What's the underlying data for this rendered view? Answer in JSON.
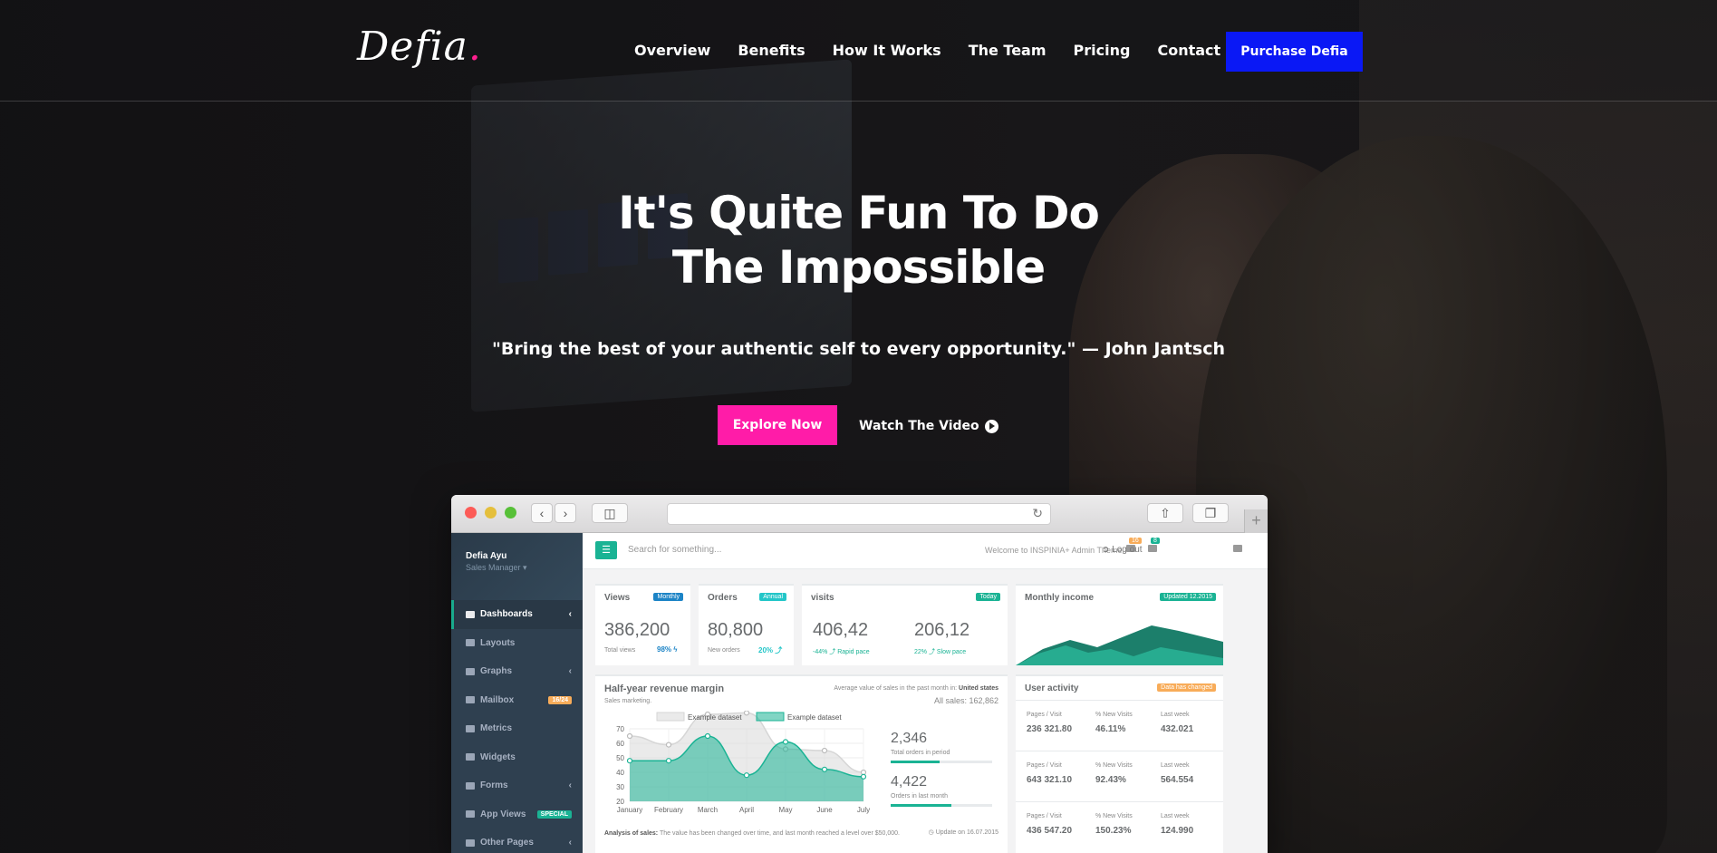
{
  "brand": {
    "logo": "Defia",
    "logo_dot": "."
  },
  "nav": {
    "items": [
      "Overview",
      "Benefits",
      "How It Works",
      "The Team",
      "Pricing",
      "Contact Us"
    ]
  },
  "header_cta": "Purchase Defia",
  "hero": {
    "title_line1": "It's Quite Fun To Do",
    "title_line2": "The Impossible",
    "quote": "\"Bring the best of your authentic self to every opportunity.\" — John Jantsch",
    "primary_button": "Explore Now",
    "secondary_button": "Watch The Video"
  },
  "colors": {
    "accent_pink": "#ff1ca8",
    "accent_blue": "#0a18f5",
    "teal": "#1ab394",
    "sidebar": "#2f4050"
  },
  "dashboard": {
    "profile": {
      "name": "Defia Ayu",
      "role": "Sales Manager ▾"
    },
    "sidebar": [
      {
        "label": "Dashboards",
        "arrow": "‹",
        "active": true
      },
      {
        "label": "Layouts"
      },
      {
        "label": "Graphs",
        "arrow": "‹"
      },
      {
        "label": "Mailbox",
        "badge": "16/24"
      },
      {
        "label": "Metrics"
      },
      {
        "label": "Widgets"
      },
      {
        "label": "Forms",
        "arrow": "‹"
      },
      {
        "label": "App Views",
        "badge": "SPECIAL"
      },
      {
        "label": "Other Pages",
        "arrow": "‹"
      }
    ],
    "topbar": {
      "search_placeholder": "Search for something...",
      "welcome": "Welcome to INSPINIA+ Admin Theme.",
      "mail_badge": "16",
      "bell_badge": "8",
      "logout": "Log out"
    },
    "stats": {
      "views": {
        "title": "Views",
        "label": "Monthly",
        "value": "386,200",
        "sub": "Total views",
        "pct": "98% ϟ"
      },
      "orders": {
        "title": "Orders",
        "label": "Annual",
        "value": "80,800",
        "sub": "New orders",
        "pct": "20% ⤴"
      },
      "visits": {
        "title": "visits",
        "label": "Today",
        "value1": "406,42",
        "sub1": "-44% ⤴ Rapid pace",
        "value2": "206,12",
        "sub2": "22% ⤴ Slow pace"
      },
      "income": {
        "title": "Monthly income",
        "label": "Updated 12.2015"
      }
    },
    "revenue": {
      "title": "Half-year revenue margin",
      "subtitle": "Sales marketing.",
      "avg_text": "Average value of sales in the past month in:",
      "avg_place": "United states",
      "all_sales": "All sales: 162,862",
      "stat1_value": "2,346",
      "stat1_label": "Total orders in period",
      "stat1_progress": 0.48,
      "stat2_value": "4,422",
      "stat2_label": "Orders in last month",
      "stat2_progress": 0.6,
      "footer_label": "Analysis of sales:",
      "footer_text": "The value has been changed over time, and last month reached a level over $50,000.",
      "update": "◷ Update on 16.07.2015"
    },
    "user_activity": {
      "title": "User activity",
      "label": "Data has changed",
      "rows": [
        {
          "h1": "Pages / Visit",
          "v1": "236 321.80",
          "h2": "% New Visits",
          "v2": "46.11%",
          "h3": "Last week",
          "v3": "432.021"
        },
        {
          "h1": "Pages / Visit",
          "v1": "643 321.10",
          "h2": "% New Visits",
          "v2": "92.43%",
          "h3": "Last week",
          "v3": "564.554"
        },
        {
          "h1": "Pages / Visit",
          "v1": "436 547.20",
          "h2": "% New Visits",
          "v2": "150.23%",
          "h3": "Last week",
          "v3": "124.990"
        }
      ]
    }
  },
  "chart_data": {
    "type": "area",
    "categories": [
      "January",
      "February",
      "March",
      "April",
      "May",
      "June",
      "July"
    ],
    "series": [
      {
        "name": "Example dataset",
        "values": [
          65,
          59,
          80,
          81,
          56,
          55,
          40
        ]
      },
      {
        "name": "Example dataset",
        "values": [
          48,
          48,
          65,
          38,
          61,
          42,
          37
        ]
      }
    ],
    "yticks": [
      "70",
      "60",
      "50",
      "40",
      "30",
      "20"
    ],
    "ylim": [
      20,
      70
    ],
    "legend": "top"
  }
}
